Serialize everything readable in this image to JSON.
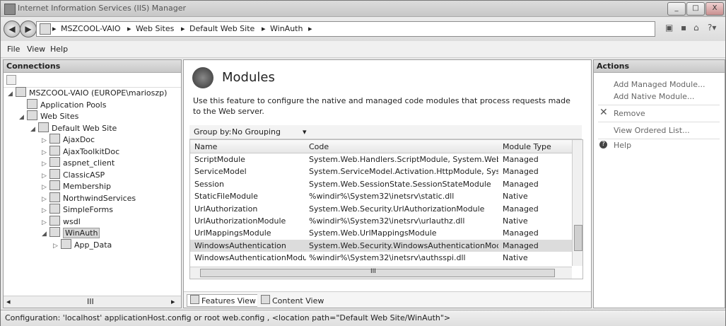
{
  "window": {
    "title": "Internet Information Services (IIS) Manager"
  },
  "window_controls": {
    "minimize": "_",
    "maximize": "□",
    "close": "X"
  },
  "address": {
    "crumbs": [
      "MSZCOOL-VAIO",
      "Web Sites",
      "Default Web Site",
      "WinAuth"
    ],
    "separator": "▸"
  },
  "menu": {
    "file": "File",
    "view": "View",
    "help": "Help"
  },
  "connections": {
    "header": "Connections",
    "tree": [
      {
        "label": "MSZCOOL-VAIO (EUROPE\\marioszp)",
        "expander": "◢"
      },
      {
        "label": "Application Pools",
        "expander": ""
      },
      {
        "label": "Web Sites",
        "expander": "◢"
      },
      {
        "label": "Default Web Site",
        "expander": "◢"
      },
      {
        "label": "AjaxDoc",
        "expander": "▷"
      },
      {
        "label": "AjaxToolkitDoc",
        "expander": "▷"
      },
      {
        "label": "aspnet_client",
        "expander": "▷"
      },
      {
        "label": "ClassicASP",
        "expander": "▷"
      },
      {
        "label": "Membership",
        "expander": "▷"
      },
      {
        "label": "NorthwindServices",
        "expander": "▷"
      },
      {
        "label": "SimpleForms",
        "expander": "▷"
      },
      {
        "label": "wsdl",
        "expander": "▷"
      },
      {
        "label": "WinAuth",
        "expander": "◢"
      },
      {
        "label": "App_Data",
        "expander": "▷"
      }
    ],
    "scroll_label": "III"
  },
  "feature": {
    "title": "Modules",
    "description": "Use this feature to configure the native and managed code modules that process requests made to the Web server.",
    "group_by_label": "Group by:",
    "group_by_value": "No Grouping",
    "columns": [
      "Name",
      "Code",
      "Module Type"
    ],
    "rows": [
      [
        "ScriptModule",
        "System.Web.Handlers.ScriptModule, System.Web.Ex...",
        "Managed"
      ],
      [
        "ServiceModel",
        "System.ServiceModel.Activation.HttpModule, Syste...",
        "Managed"
      ],
      [
        "Session",
        "System.Web.SessionState.SessionStateModule",
        "Managed"
      ],
      [
        "StaticFileModule",
        "%windir%\\System32\\inetsrv\\static.dll",
        "Native"
      ],
      [
        "UrlAuthorization",
        "System.Web.Security.UrlAuthorizationModule",
        "Managed"
      ],
      [
        "UrlAuthorizationModule",
        "%windir%\\System32\\inetsrv\\urlauthz.dll",
        "Native"
      ],
      [
        "UrlMappingsModule",
        "System.Web.UrlMappingsModule",
        "Managed"
      ],
      [
        "WindowsAuthentication",
        "System.Web.Security.WindowsAuthenticationModule",
        "Managed"
      ],
      [
        "WindowsAuthenticationModule",
        "%windir%\\System32\\inetsrv\\authsspi.dll",
        "Native"
      ]
    ],
    "hscroll_label": "III",
    "tabs": {
      "features": "Features View",
      "content": "Content View"
    }
  },
  "actions": {
    "header": "Actions",
    "items": [
      "Add Managed Module...",
      "Add Native Module...",
      "Remove",
      "View Ordered List...",
      "Help"
    ]
  },
  "status": {
    "text": "Configuration: 'localhost' applicationHost.config or root web.config , <location path=\"Default Web Site/WinAuth\">"
  }
}
